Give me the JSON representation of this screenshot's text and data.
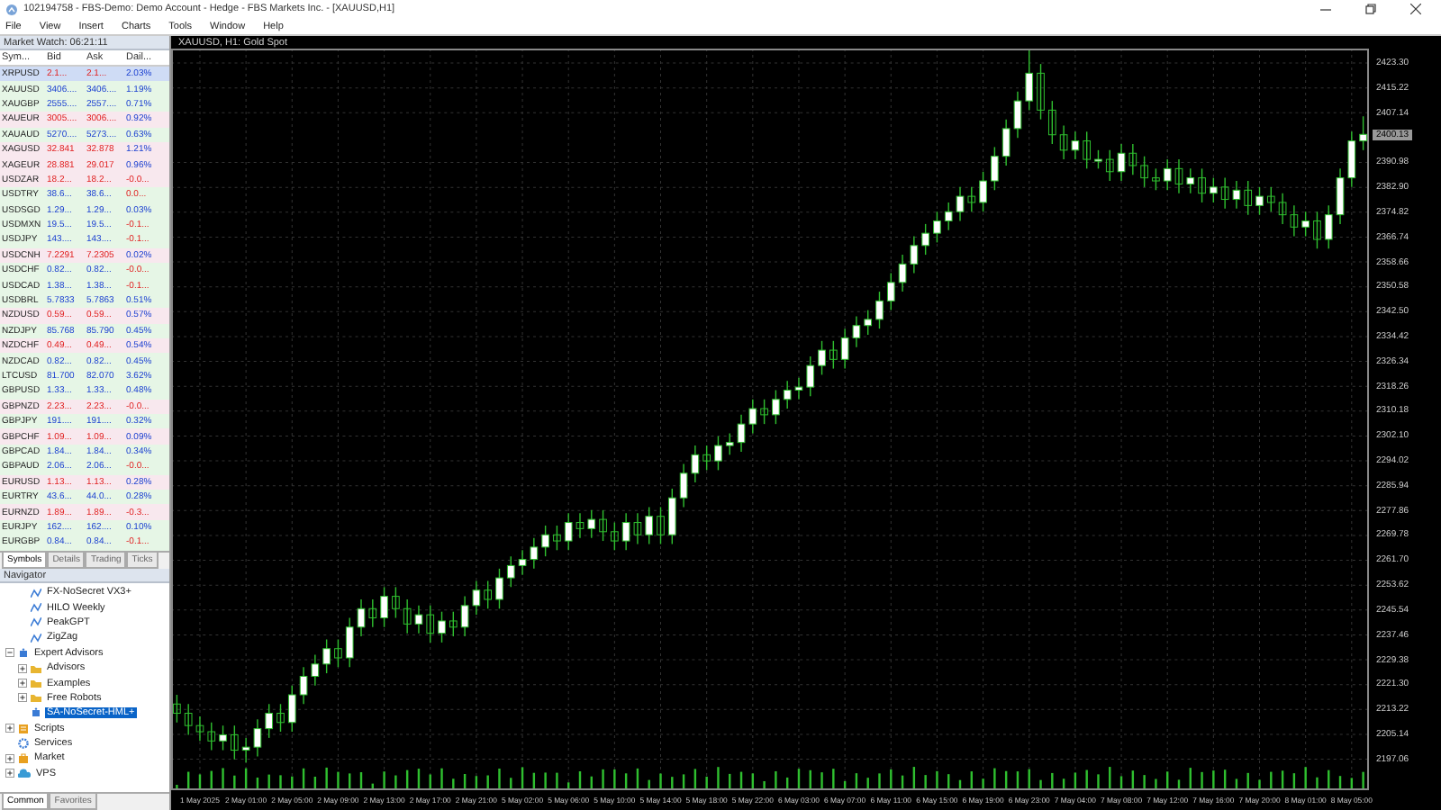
{
  "window": {
    "title": "102194758 - FBS-Demo: Demo Account - Hedge - FBS Markets Inc. - [XAUUSD,H1]"
  },
  "menu": [
    "File",
    "View",
    "Insert",
    "Charts",
    "Tools",
    "Window",
    "Help"
  ],
  "market_watch": {
    "title": "Market Watch: 06:21:11",
    "columns": [
      "Sym...",
      "Bid",
      "Ask",
      "Dail..."
    ],
    "rows": [
      {
        "symbol": "XRPUSD",
        "bid": "2.1...",
        "ask": "2.1...",
        "change": "2.03%",
        "rising": false,
        "change_up": true,
        "selected": true
      },
      {
        "symbol": "XAUUSD",
        "bid": "3406....",
        "ask": "3406....",
        "change": "1.19%",
        "rising": true,
        "change_up": true,
        "selected": false
      },
      {
        "symbol": "XAUGBP",
        "bid": "2555....",
        "ask": "2557....",
        "change": "0.71%",
        "rising": true,
        "change_up": true,
        "selected": false
      },
      {
        "symbol": "XAUEUR",
        "bid": "3005....",
        "ask": "3006....",
        "change": "0.92%",
        "rising": false,
        "change_up": true,
        "selected": false
      },
      {
        "symbol": "XAUAUD",
        "bid": "5270....",
        "ask": "5273....",
        "change": "0.63%",
        "rising": true,
        "change_up": true,
        "selected": false
      },
      {
        "symbol": "XAGUSD",
        "bid": "32.841",
        "ask": "32.878",
        "change": "1.21%",
        "rising": false,
        "change_up": true,
        "selected": false
      },
      {
        "symbol": "XAGEUR",
        "bid": "28.881",
        "ask": "29.017",
        "change": "0.96%",
        "rising": false,
        "change_up": true,
        "selected": false
      },
      {
        "symbol": "USDZAR",
        "bid": "18.2...",
        "ask": "18.2...",
        "change": "-0.0...",
        "rising": false,
        "change_up": false,
        "selected": false
      },
      {
        "symbol": "USDTRY",
        "bid": "38.6...",
        "ask": "38.6...",
        "change": "0.0...",
        "rising": true,
        "change_up": false,
        "selected": false
      },
      {
        "symbol": "USDSGD",
        "bid": "1.29...",
        "ask": "1.29...",
        "change": "0.03%",
        "rising": true,
        "change_up": true,
        "selected": false
      },
      {
        "symbol": "USDMXN",
        "bid": "19.5...",
        "ask": "19.5...",
        "change": "-0.1...",
        "rising": true,
        "change_up": false,
        "selected": false
      },
      {
        "symbol": "USDJPY",
        "bid": "143....",
        "ask": "143....",
        "change": "-0.1...",
        "rising": true,
        "change_up": false,
        "selected": false
      },
      {
        "symbol": "USDCNH",
        "bid": "7.2291",
        "ask": "7.2305",
        "change": "0.02%",
        "rising": false,
        "change_up": true,
        "selected": false
      },
      {
        "symbol": "USDCHF",
        "bid": "0.82...",
        "ask": "0.82...",
        "change": "-0.0...",
        "rising": true,
        "change_up": false,
        "selected": false
      },
      {
        "symbol": "USDCAD",
        "bid": "1.38...",
        "ask": "1.38...",
        "change": "-0.1...",
        "rising": true,
        "change_up": false,
        "selected": false
      },
      {
        "symbol": "USDBRL",
        "bid": "5.7833",
        "ask": "5.7863",
        "change": "0.51%",
        "rising": true,
        "change_up": true,
        "selected": false
      },
      {
        "symbol": "NZDUSD",
        "bid": "0.59...",
        "ask": "0.59...",
        "change": "0.57%",
        "rising": false,
        "change_up": true,
        "selected": false
      },
      {
        "symbol": "NZDJPY",
        "bid": "85.768",
        "ask": "85.790",
        "change": "0.45%",
        "rising": true,
        "change_up": true,
        "selected": false
      },
      {
        "symbol": "NZDCHF",
        "bid": "0.49...",
        "ask": "0.49...",
        "change": "0.54%",
        "rising": false,
        "change_up": true,
        "selected": false
      },
      {
        "symbol": "NZDCAD",
        "bid": "0.82...",
        "ask": "0.82...",
        "change": "0.45%",
        "rising": true,
        "change_up": true,
        "selected": false
      },
      {
        "symbol": "LTCUSD",
        "bid": "81.700",
        "ask": "82.070",
        "change": "3.62%",
        "rising": true,
        "change_up": true,
        "selected": false
      },
      {
        "symbol": "GBPUSD",
        "bid": "1.33...",
        "ask": "1.33...",
        "change": "0.48%",
        "rising": true,
        "change_up": true,
        "selected": false
      },
      {
        "symbol": "GBPNZD",
        "bid": "2.23...",
        "ask": "2.23...",
        "change": "-0.0...",
        "rising": false,
        "change_up": false,
        "selected": false
      },
      {
        "symbol": "GBPJPY",
        "bid": "191....",
        "ask": "191....",
        "change": "0.32%",
        "rising": true,
        "change_up": true,
        "selected": false
      },
      {
        "symbol": "GBPCHF",
        "bid": "1.09...",
        "ask": "1.09...",
        "change": "0.09%",
        "rising": false,
        "change_up": true,
        "selected": false
      },
      {
        "symbol": "GBPCAD",
        "bid": "1.84...",
        "ask": "1.84...",
        "change": "0.34%",
        "rising": true,
        "change_up": true,
        "selected": false
      },
      {
        "symbol": "GBPAUD",
        "bid": "2.06...",
        "ask": "2.06...",
        "change": "-0.0...",
        "rising": true,
        "change_up": false,
        "selected": false
      },
      {
        "symbol": "EURUSD",
        "bid": "1.13...",
        "ask": "1.13...",
        "change": "0.28%",
        "rising": false,
        "change_up": true,
        "selected": false
      },
      {
        "symbol": "EURTRY",
        "bid": "43.6...",
        "ask": "44.0...",
        "change": "0.28%",
        "rising": true,
        "change_up": true,
        "selected": false
      },
      {
        "symbol": "EURNZD",
        "bid": "1.89...",
        "ask": "1.89...",
        "change": "-0.3...",
        "rising": false,
        "change_up": false,
        "selected": false
      },
      {
        "symbol": "EURJPY",
        "bid": "162....",
        "ask": "162....",
        "change": "0.10%",
        "rising": true,
        "change_up": true,
        "selected": false
      },
      {
        "symbol": "EURGBP",
        "bid": "0.84...",
        "ask": "0.84...",
        "change": "-0.1...",
        "rising": true,
        "change_up": false,
        "selected": false
      }
    ],
    "tabs": [
      {
        "label": "Symbols",
        "selected": true
      },
      {
        "label": "Details",
        "selected": false
      },
      {
        "label": "Trading",
        "selected": false
      },
      {
        "label": "Ticks",
        "selected": false
      }
    ]
  },
  "navigator": {
    "title": "Navigator",
    "items": [
      {
        "kind": "continued",
        "children": [
          {
            "kind": "indicator",
            "label": "FX-NoSecret VX3+",
            "selected": false
          },
          {
            "kind": "indicator",
            "label": "HILO Weekly",
            "selected": false
          },
          {
            "kind": "indicator",
            "label": "PeakGPT",
            "selected": false
          },
          {
            "kind": "indicator",
            "label": "ZigZag",
            "selected": false
          }
        ]
      },
      {
        "kind": "experts",
        "label": "Expert Advisors",
        "expanded": true,
        "selected": false,
        "children": [
          {
            "kind": "folder",
            "label": "Advisors",
            "expanded": false,
            "selected": false
          },
          {
            "kind": "folder",
            "label": "Examples",
            "expanded": false,
            "selected": false
          },
          {
            "kind": "folder",
            "label": "Free Robots",
            "expanded": false,
            "selected": false
          },
          {
            "kind": "expert",
            "label": "SA-NoSecret-HML+",
            "selected": true
          }
        ]
      },
      {
        "kind": "scripts",
        "label": "Scripts",
        "expanded": false,
        "selected": false
      },
      {
        "kind": "services",
        "label": "Services",
        "selected": false
      },
      {
        "kind": "market",
        "label": "Market",
        "expanded": false,
        "selected": false
      },
      {
        "kind": "vps",
        "label": "VPS",
        "expanded": false,
        "selected": false
      }
    ],
    "tabs": [
      {
        "label": "Common",
        "selected": true
      },
      {
        "label": "Favorites",
        "selected": false
      }
    ]
  },
  "chart": {
    "tab": "XAUUSD, H1: Gold Spot",
    "chart_data": {
      "type": "candlestick",
      "ylim": [
        2187,
        2428
      ],
      "grid": true,
      "categories": [
        null,
        null,
        "1 May 2025",
        null,
        null,
        null,
        "2 May 01:00",
        null,
        null,
        null,
        "2 May 05:00",
        null,
        null,
        null,
        "2 May 09:00",
        null,
        null,
        null,
        "2 May 13:00",
        null,
        null,
        null,
        "2 May 17:00",
        null,
        null,
        null,
        "2 May 21:00",
        null,
        null,
        null,
        "5 May 02:00",
        null,
        null,
        null,
        "5 May 06:00",
        null,
        null,
        null,
        "5 May 10:00",
        null,
        null,
        null,
        "5 May 14:00",
        null,
        null,
        null,
        "5 May 18:00",
        null,
        null,
        null,
        "5 May 22:00",
        null,
        null,
        null,
        "6 May 03:00",
        null,
        null,
        null,
        "6 May 07:00",
        null,
        null,
        null,
        "6 May 11:00",
        null,
        null,
        null,
        "6 May 15:00",
        null,
        null,
        null,
        "6 May 19:00",
        null,
        null,
        null,
        "6 May 23:00",
        null,
        null,
        null,
        "7 May 04:00",
        null,
        null,
        null,
        "7 May 08:00",
        null,
        null,
        null,
        "7 May 12:00",
        null,
        null,
        null,
        "7 May 16:00",
        null,
        null,
        null,
        "7 May 20:00",
        null,
        null,
        null,
        "8 May 01:00",
        null,
        null,
        null,
        "8 May 05:00",
        null
      ],
      "annotations": [
        "2400.13"
      ],
      "yticks": [
        {
          "value": 2423.3,
          "label": "2423.30"
        },
        {
          "value": 2415.22,
          "label": "2415.22"
        },
        {
          "value": 2407.14,
          "label": "2407.14"
        },
        {
          "value": 2390.98,
          "label": "2390.98"
        },
        {
          "value": 2382.9,
          "label": "2382.90"
        },
        {
          "value": 2374.82,
          "label": "2374.82"
        },
        {
          "value": 2366.74,
          "label": "2366.74"
        },
        {
          "value": 2358.66,
          "label": "2358.66"
        },
        {
          "value": 2350.58,
          "label": "2350.58"
        },
        {
          "value": 2342.5,
          "label": "2342.50"
        },
        {
          "value": 2334.42,
          "label": "2334.42"
        },
        {
          "value": 2326.34,
          "label": "2326.34"
        },
        {
          "value": 2318.26,
          "label": "2318.26"
        },
        {
          "value": 2310.18,
          "label": "2310.18"
        },
        {
          "value": 2302.1,
          "label": "2302.10"
        },
        {
          "value": 2294.02,
          "label": "2294.02"
        },
        {
          "value": 2285.94,
          "label": "2285.94"
        },
        {
          "value": 2277.86,
          "label": "2277.86"
        },
        {
          "value": 2269.78,
          "label": "2269.78"
        },
        {
          "value": 2261.7,
          "label": "2261.70"
        },
        {
          "value": 2253.62,
          "label": "2253.62"
        },
        {
          "value": 2245.54,
          "label": "2245.54"
        },
        {
          "value": 2237.46,
          "label": "2237.46"
        },
        {
          "value": 2229.38,
          "label": "2229.38"
        },
        {
          "value": 2221.3,
          "label": "2221.30"
        },
        {
          "value": 2213.22,
          "label": "2213.22"
        },
        {
          "value": 2205.14,
          "label": "2205.14"
        },
        {
          "value": 2197.06,
          "label": "2197.06"
        }
      ],
      "ohlc": [
        [
          2215,
          2218,
          2209,
          2212
        ],
        [
          2212,
          2215,
          2205,
          2208
        ],
        [
          2208,
          2211,
          2203,
          2206
        ],
        [
          2206,
          2209,
          2200,
          2203
        ],
        [
          2203,
          2208,
          2200,
          2205
        ],
        [
          2205,
          2208,
          2197,
          2200
        ],
        [
          2200,
          2204,
          2196,
          2201
        ],
        [
          2201,
          2210,
          2198,
          2207
        ],
        [
          2207,
          2215,
          2204,
          2212
        ],
        [
          2212,
          2215,
          2206,
          2209
        ],
        [
          2209,
          2221,
          2206,
          2218
        ],
        [
          2218,
          2227,
          2215,
          2224
        ],
        [
          2224,
          2231,
          2221,
          2228
        ],
        [
          2228,
          2236,
          2225,
          2233
        ],
        [
          2233,
          2236,
          2227,
          2230
        ],
        [
          2230,
          2243,
          2227,
          2240
        ],
        [
          2240,
          2249,
          2237,
          2246
        ],
        [
          2246,
          2249,
          2240,
          2243
        ],
        [
          2243,
          2253,
          2240,
          2250
        ],
        [
          2250,
          2253,
          2243,
          2246
        ],
        [
          2246,
          2249,
          2238,
          2241
        ],
        [
          2241,
          2247,
          2238,
          2244
        ],
        [
          2244,
          2247,
          2235,
          2238
        ],
        [
          2238,
          2245,
          2235,
          2242
        ],
        [
          2242,
          2245,
          2237,
          2240
        ],
        [
          2240,
          2250,
          2237,
          2247
        ],
        [
          2247,
          2255,
          2244,
          2252
        ],
        [
          2252,
          2255,
          2246,
          2249
        ],
        [
          2249,
          2259,
          2246,
          2256
        ],
        [
          2256,
          2263,
          2253,
          2260
        ],
        [
          2260,
          2265,
          2257,
          2262
        ],
        [
          2262,
          2269,
          2259,
          2266
        ],
        [
          2266,
          2273,
          2263,
          2270
        ],
        [
          2270,
          2273,
          2265,
          2268
        ],
        [
          2268,
          2277,
          2265,
          2274
        ],
        [
          2274,
          2277,
          2269,
          2272
        ],
        [
          2272,
          2278,
          2269,
          2275
        ],
        [
          2275,
          2278,
          2268,
          2271
        ],
        [
          2271,
          2274,
          2265,
          2268
        ],
        [
          2268,
          2277,
          2265,
          2274
        ],
        [
          2274,
          2277,
          2267,
          2270
        ],
        [
          2270,
          2279,
          2267,
          2276
        ],
        [
          2276,
          2279,
          2267,
          2270
        ],
        [
          2270,
          2285,
          2267,
          2282
        ],
        [
          2282,
          2293,
          2279,
          2290
        ],
        [
          2290,
          2299,
          2287,
          2296
        ],
        [
          2296,
          2299,
          2291,
          2294
        ],
        [
          2294,
          2302,
          2291,
          2299
        ],
        [
          2299,
          2303,
          2296,
          2300
        ],
        [
          2300,
          2309,
          2297,
          2306
        ],
        [
          2306,
          2314,
          2303,
          2311
        ],
        [
          2311,
          2314,
          2306,
          2309
        ],
        [
          2309,
          2317,
          2306,
          2314
        ],
        [
          2314,
          2320,
          2311,
          2317
        ],
        [
          2317,
          2321,
          2314,
          2318
        ],
        [
          2318,
          2328,
          2315,
          2325
        ],
        [
          2325,
          2333,
          2322,
          2330
        ],
        [
          2330,
          2333,
          2324,
          2327
        ],
        [
          2327,
          2337,
          2324,
          2334
        ],
        [
          2334,
          2341,
          2331,
          2338
        ],
        [
          2338,
          2343,
          2335,
          2340
        ],
        [
          2340,
          2349,
          2337,
          2346
        ],
        [
          2346,
          2355,
          2343,
          2352
        ],
        [
          2352,
          2361,
          2349,
          2358
        ],
        [
          2358,
          2367,
          2355,
          2364
        ],
        [
          2364,
          2371,
          2361,
          2368
        ],
        [
          2368,
          2375,
          2365,
          2372
        ],
        [
          2372,
          2378,
          2369,
          2375
        ],
        [
          2375,
          2383,
          2372,
          2380
        ],
        [
          2380,
          2383,
          2375,
          2378
        ],
        [
          2378,
          2388,
          2375,
          2385
        ],
        [
          2385,
          2396,
          2382,
          2393
        ],
        [
          2393,
          2405,
          2390,
          2402
        ],
        [
          2402,
          2414,
          2399,
          2411
        ],
        [
          2411,
          2428,
          2408,
          2420
        ],
        [
          2420,
          2423,
          2405,
          2408
        ],
        [
          2408,
          2411,
          2397,
          2400
        ],
        [
          2400,
          2403,
          2392,
          2395
        ],
        [
          2395,
          2401,
          2392,
          2398
        ],
        [
          2398,
          2401,
          2389,
          2392
        ],
        [
          2392,
          2395,
          2389,
          2392
        ],
        [
          2392,
          2395,
          2385,
          2388
        ],
        [
          2388,
          2397,
          2385,
          2394
        ],
        [
          2394,
          2397,
          2387,
          2390
        ],
        [
          2390,
          2393,
          2383,
          2386
        ],
        [
          2386,
          2389,
          2382,
          2385
        ],
        [
          2385,
          2392,
          2382,
          2389
        ],
        [
          2389,
          2392,
          2381,
          2384
        ],
        [
          2384,
          2389,
          2381,
          2386
        ],
        [
          2386,
          2389,
          2378,
          2381
        ],
        [
          2381,
          2386,
          2378,
          2383
        ],
        [
          2383,
          2386,
          2376,
          2379
        ],
        [
          2379,
          2385,
          2376,
          2382
        ],
        [
          2382,
          2385,
          2374,
          2377
        ],
        [
          2377,
          2383,
          2374,
          2380
        ],
        [
          2380,
          2383,
          2375,
          2378
        ],
        [
          2378,
          2381,
          2371,
          2374
        ],
        [
          2374,
          2377,
          2367,
          2370
        ],
        [
          2370,
          2375,
          2367,
          2372
        ],
        [
          2372,
          2375,
          2363,
          2366
        ],
        [
          2366,
          2377,
          2363,
          2374
        ],
        [
          2374,
          2389,
          2371,
          2386
        ],
        [
          2386,
          2401,
          2383,
          2398
        ],
        [
          2398,
          2406,
          2395,
          2400.13
        ]
      ]
    }
  }
}
